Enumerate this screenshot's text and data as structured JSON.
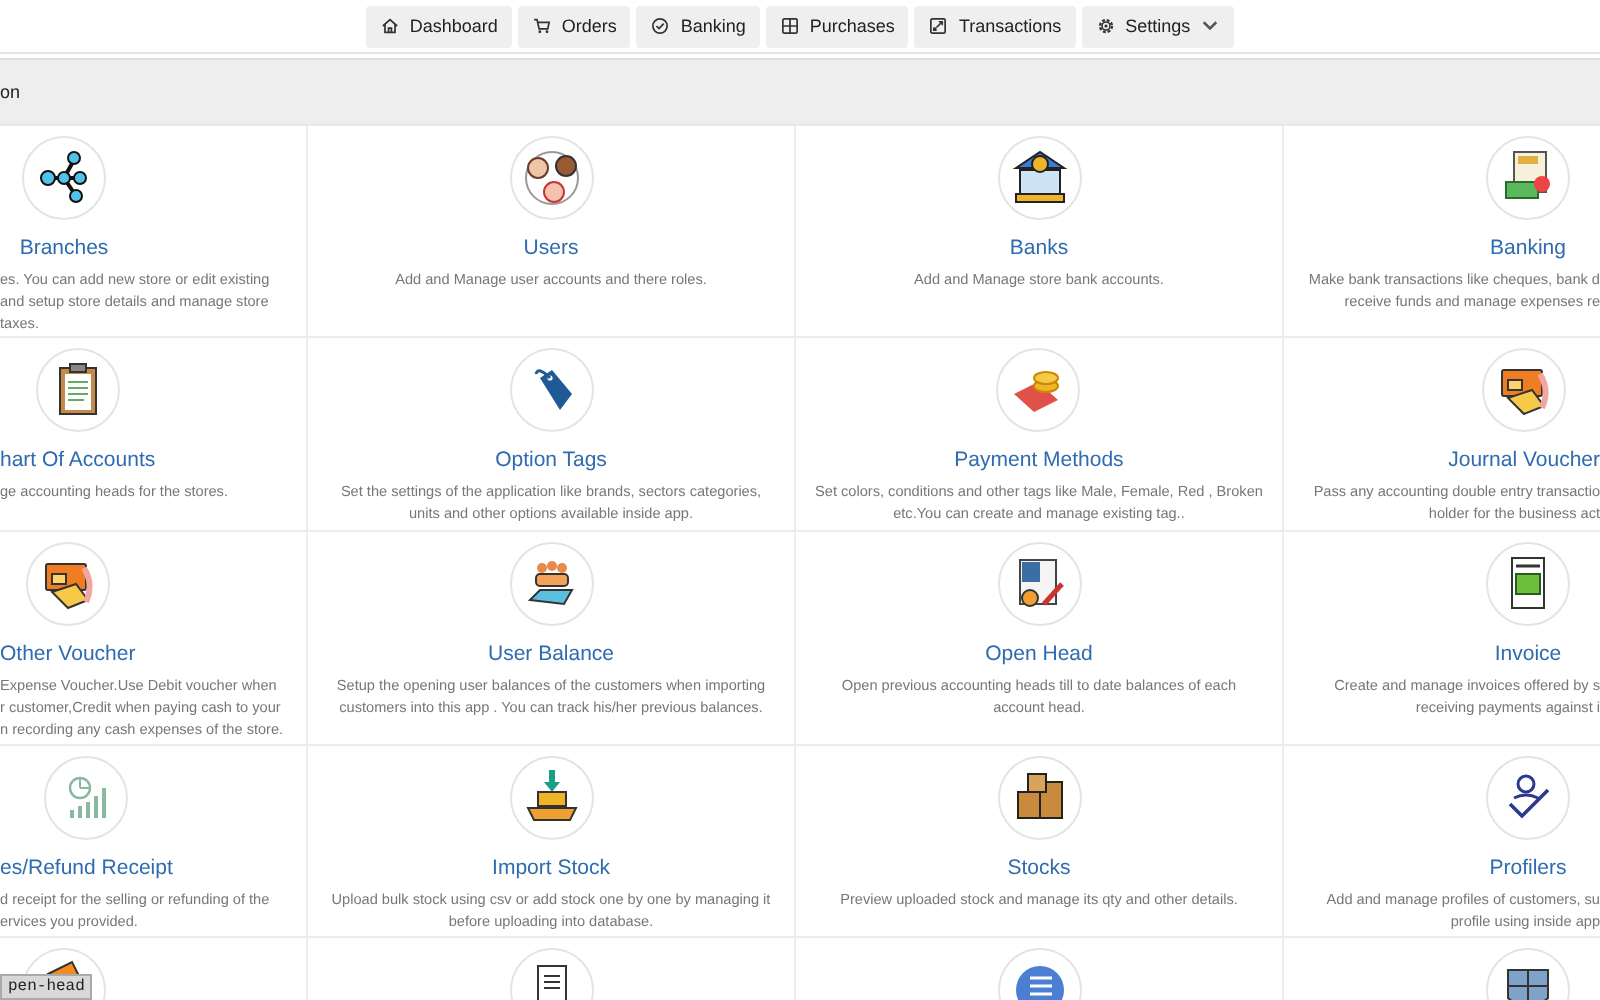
{
  "nav": [
    {
      "label": "Dashboard",
      "has_menu": false
    },
    {
      "label": "Orders",
      "has_menu": false
    },
    {
      "label": "Banking",
      "has_menu": false
    },
    {
      "label": "Purchases",
      "has_menu": false
    },
    {
      "label": "Transactions",
      "has_menu": false
    },
    {
      "label": "Settings",
      "has_menu": true
    }
  ],
  "band": {
    "text": "on"
  },
  "cards": [
    {
      "title": "Branches",
      "lines": [
        "es. You can add new store or edit existing",
        "and setup store details and manage store",
        "taxes."
      ]
    },
    {
      "title": "Users",
      "lines": [
        "Add and Manage user accounts and there roles."
      ]
    },
    {
      "title": "Banks",
      "lines": [
        "Add and Manage store bank accounts."
      ]
    },
    {
      "title": "Banking",
      "lines": [
        "Make bank transactions like cheques, bank d",
        "receive funds and manage expenses re"
      ]
    },
    {
      "title": "hart Of Accounts",
      "lines": [
        "ge accounting heads for the stores."
      ]
    },
    {
      "title": "Option Tags",
      "lines": [
        "Set the settings of the application like brands, sectors categories,",
        "units and other options available inside app."
      ]
    },
    {
      "title": "Payment Methods",
      "lines": [
        "Set colors, conditions and other tags like Male, Female, Red , Broken",
        "etc.You can create and manage existing tag.."
      ]
    },
    {
      "title": "Journal Voucher",
      "lines": [
        "Pass any accounting double entry transactio",
        "holder for the business act"
      ]
    },
    {
      "title": "Other Voucher",
      "lines": [
        "Expense Voucher.Use Debit voucher when",
        "r customer,Credit when paying cash to your",
        "n recording any cash expenses of the store."
      ]
    },
    {
      "title": "User Balance",
      "lines": [
        "Setup the opening user balances of the customers when importing",
        "customers into this app . You can track his/her previous balances."
      ]
    },
    {
      "title": "Open Head",
      "lines": [
        "Open previous accounting heads till to date balances of each",
        "account head."
      ]
    },
    {
      "title": "Invoice",
      "lines": [
        "Create and manage invoices offered by s",
        "receiving payments against i"
      ]
    },
    {
      "title": "es/Refund Receipt",
      "lines": [
        "d receipt for the selling or refunding of the",
        "ervices you provided."
      ]
    },
    {
      "title": "Import Stock",
      "lines": [
        "Upload bulk stock using csv or add stock one by one by managing it",
        "before uploading into database."
      ]
    },
    {
      "title": "Stocks",
      "lines": [
        "Preview uploaded stock and manage its qty and other details."
      ]
    },
    {
      "title": "Profilers",
      "lines": [
        "Add and manage profiles of customers, su",
        "profile using inside app"
      ]
    }
  ],
  "tooltip": {
    "text": "pen-head"
  }
}
